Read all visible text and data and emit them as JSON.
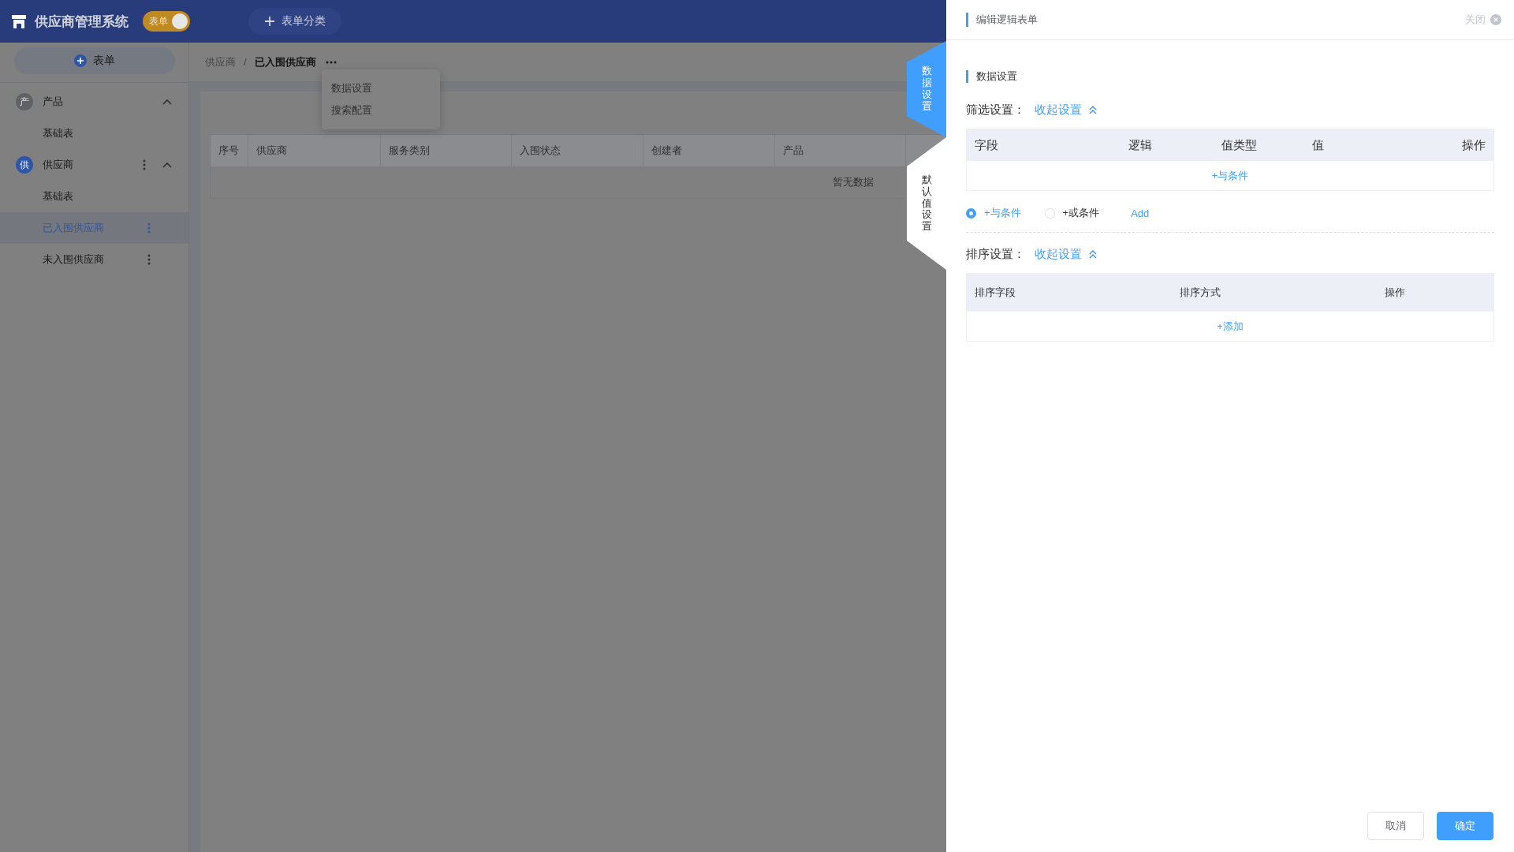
{
  "app": {
    "title": "供应商管理系统",
    "mode_switch": {
      "label": "表单",
      "on": true
    },
    "category_button": "表单分类"
  },
  "sidebar": {
    "add_button": "表单",
    "groups": [
      {
        "name": "产品",
        "avatar": "产",
        "color": "#5f6166",
        "has_menu": false,
        "expanded": true,
        "items": [
          {
            "label": "基础表",
            "selected": false,
            "has_menu": false
          }
        ]
      },
      {
        "name": "供应商",
        "avatar": "供",
        "color": "#2d56a8",
        "has_menu": true,
        "expanded": true,
        "items": [
          {
            "label": "基础表",
            "selected": false,
            "has_menu": false
          },
          {
            "label": "已入围供应商",
            "selected": true,
            "has_menu": true
          },
          {
            "label": "未入围供应商",
            "selected": false,
            "has_menu": true
          }
        ]
      }
    ]
  },
  "breadcrumb": {
    "separator": "/",
    "items": [
      "供应商",
      "已入围供应商"
    ]
  },
  "more_menu": [
    "数据设置",
    "搜索配置"
  ],
  "table": {
    "columns": [
      "序号",
      "供应商",
      "服务类别",
      "入围状态",
      "创建者",
      "产品"
    ],
    "empty_text": "暂无数据"
  },
  "panel": {
    "title": "编辑逻辑表单",
    "close_label": "关闭",
    "side_tabs": [
      {
        "label": "数据设置",
        "selected": true
      },
      {
        "label": "默认值设置",
        "selected": false
      }
    ],
    "section_title": "数据设置",
    "filter": {
      "label": "筛选设置：",
      "collapse_link": "收起设置",
      "columns": [
        "字段",
        "逻辑",
        "值类型",
        "值",
        "操作"
      ],
      "add_link": "+与条件",
      "logic_options": [
        {
          "label": "+与条件",
          "selected": true
        },
        {
          "label": "+或条件",
          "selected": false
        }
      ],
      "add_button": "Add"
    },
    "sort": {
      "label": "排序设置：",
      "collapse_link": "收起设置",
      "columns": [
        "排序字段",
        "排序方式",
        "操作"
      ],
      "add_link": "+添加"
    },
    "buttons": [
      {
        "label": "取消",
        "kind": "default"
      },
      {
        "label": "确定",
        "kind": "primary"
      }
    ]
  }
}
